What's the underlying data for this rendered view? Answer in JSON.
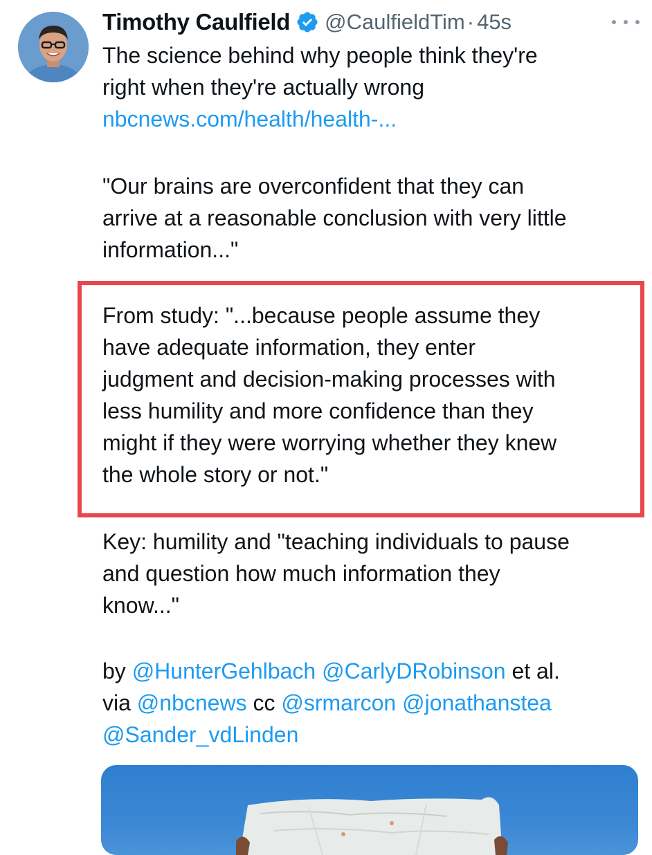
{
  "tweet": {
    "author": {
      "name": "Timothy Caulfield",
      "handle": "@CaulfieldTim",
      "verified": true,
      "avatar_icon": "profile-photo"
    },
    "separator": "·",
    "timestamp": "45s",
    "more_icon": "more-horizontal-icon",
    "paragraphs": {
      "p1": {
        "line1": "The science behind why people think they're",
        "line2": "right when they're actually wrong",
        "link": "nbcnews.com/health/health-..."
      },
      "p2": {
        "line1": "\"Our brains are overconfident that they can",
        "line2": "arrive at a reasonable conclusion with very little",
        "line3": "information...\""
      },
      "p3": {
        "line1": "From study: \"...because people assume they",
        "line2": "have adequate information, they enter",
        "line3": "judgment and decision-making processes with",
        "line4": "less humility and more confidence than they",
        "line5": "might if they were worrying whether they knew",
        "line6": "the whole story or not.\""
      },
      "p4": {
        "line1": "Key: humility and \"teaching individuals to pause",
        "line2": "and question how much information they",
        "line3": "know...\""
      },
      "p5": {
        "by": "by",
        "mention1": "@HunterGehlbach",
        "mention2": "@CarlyDRobinson",
        "etal": "et al.",
        "via": "via",
        "mention3": "@nbcnews",
        "cc": "cc",
        "mention4": "@srmarcon",
        "mention5": "@jonathanstea",
        "mention6": "@Sander_vdLinden"
      }
    },
    "media": {
      "description_icon": "person-holding-map-image"
    },
    "colors": {
      "link": "#1d9bf0",
      "highlight_border": "#e8474d",
      "secondary_text": "#536471"
    }
  }
}
